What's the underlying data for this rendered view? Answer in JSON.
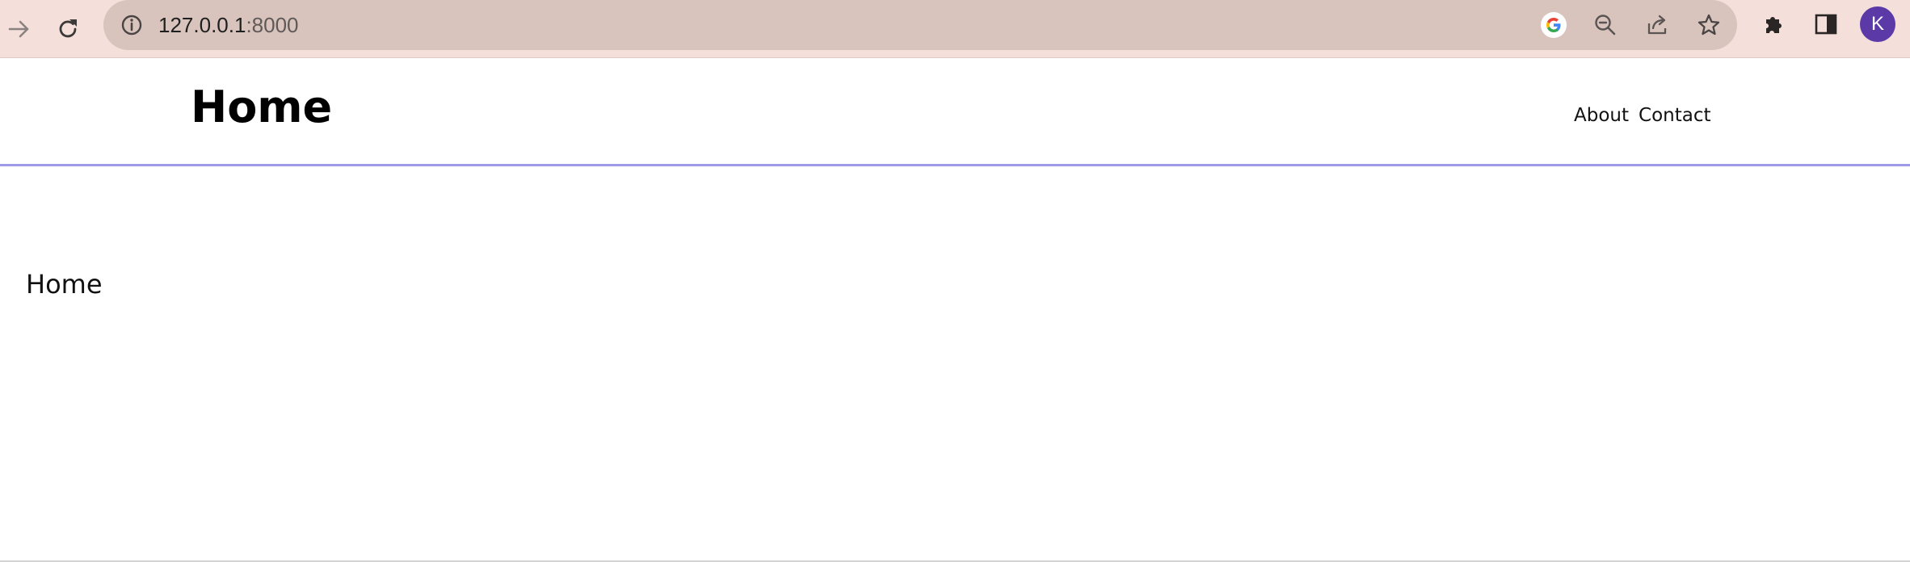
{
  "browser": {
    "url_host": "127.0.0.1",
    "url_rest": ":8000",
    "avatar_letter": "K",
    "icons": {
      "forward": "arrow-right-icon",
      "reload": "reload-icon",
      "info": "info-icon",
      "google": "google-icon",
      "zoom": "zoom-out-icon",
      "share": "share-icon",
      "bookmark": "star-icon",
      "extensions": "puzzle-icon",
      "side_panel": "side-panel-icon"
    },
    "colors": {
      "toolbar_bg": "#f5dfda",
      "omnibox_bg": "#d9c4bd",
      "avatar_bg": "#5b3aa8"
    }
  },
  "header": {
    "title": "Home",
    "nav": {
      "about": "About",
      "contact": "Contact"
    },
    "border_color": "#9f9be8"
  },
  "main": {
    "heading": "Home"
  }
}
